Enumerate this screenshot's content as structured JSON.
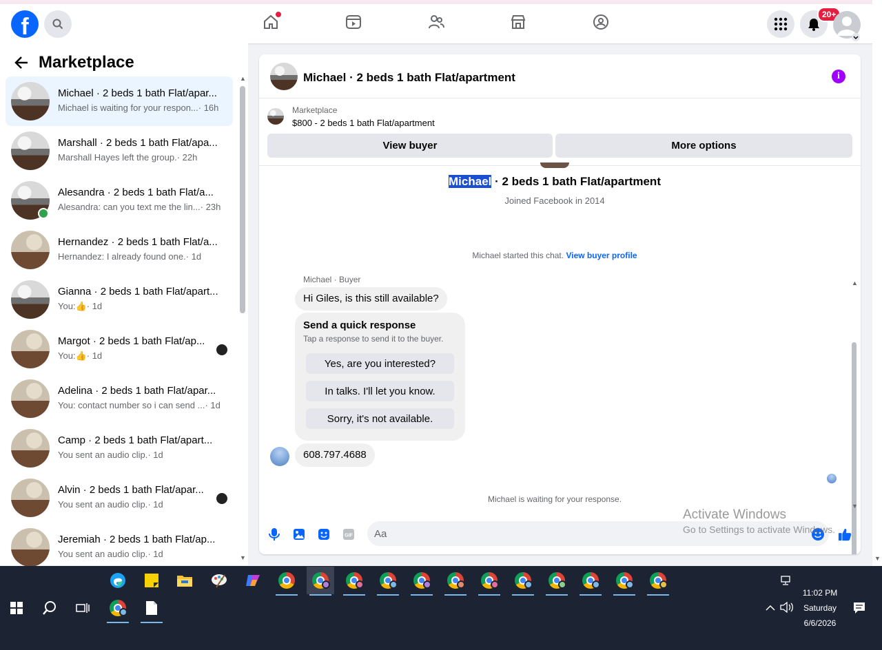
{
  "topbar": {
    "logo_letter": "f",
    "notification_badge": "20+",
    "icons": [
      "search-icon",
      "home-icon",
      "video-icon",
      "friends-icon",
      "marketplace-icon",
      "groups-icon",
      "menu-grid-icon",
      "bell-icon",
      "account-icon"
    ]
  },
  "left": {
    "title": "Marketplace",
    "conversations": [
      {
        "title": "Michael · 2 beds 1 bath Flat/apar...",
        "preview": "Michael is waiting for your respon...",
        "time": "· 16h",
        "active": true
      },
      {
        "title": "Marshall · 2 beds 1 bath Flat/apa...",
        "preview": "Marshall Hayes left the group.",
        "time": "· 22h"
      },
      {
        "title": "Alesandra · 2 beds 1 bath Flat/a...",
        "preview": "Alesandra: can you text me the lin...",
        "time": "· 23h",
        "online": true
      },
      {
        "title": "Hernandez · 2 beds 1 bath Flat/a...",
        "preview": "Hernandez: I already found one.",
        "time": "· 1d"
      },
      {
        "title": "Gianna · 2 beds 1 bath Flat/apart...",
        "preview": "You:",
        "time": "· 1d",
        "like": true
      },
      {
        "title": "Margot · 2 beds 1 bath Flat/ap...",
        "preview": "You:",
        "time": "· 1d",
        "like": true,
        "seen": true
      },
      {
        "title": "Adelina · 2 beds 1 bath Flat/apar...",
        "preview": "You: contact number so i can send ...",
        "time": "· 1d"
      },
      {
        "title": "Camp · 2 beds 1 bath Flat/apart...",
        "preview": "You sent an audio clip.",
        "time": "· 1d"
      },
      {
        "title": "Alvin · 2 beds 1 bath Flat/apar...",
        "preview": "You sent an audio clip.",
        "time": "· 1d",
        "seen": true
      },
      {
        "title": "Jeremiah · 2 beds 1 bath Flat/ap...",
        "preview": "You sent an audio clip.",
        "time": "· 1d"
      }
    ]
  },
  "chat": {
    "header_name": "Michael · 2 beds 1 bath Flat/apartment",
    "listing_source": "Marketplace",
    "listing_price": "$800 - 2 beds 1 bath Flat/apartment",
    "view_buyer": "View buyer",
    "more_options": "More options",
    "profile_first": "Michael",
    "profile_rest": " · 2 beds 1 bath Flat/apartment",
    "joined": "Joined Facebook in 2014",
    "started_text": "Michael started this chat.",
    "view_buyer_profile": "View buyer profile",
    "sender_label": "Michael · Buyer",
    "first_message": "Hi Giles, is this still available?",
    "quick_title": "Send a quick response",
    "quick_sub": "Tap a response to send it to the buyer.",
    "quick_options": [
      "Yes, are you interested?",
      "In talks. I'll let you know.",
      "Sorry, it's not available."
    ],
    "phone_message": "608.797.4688",
    "waiting": "Michael is waiting for your response.",
    "composer_placeholder": "Aa"
  },
  "watermark": {
    "line1": "Activate Windows",
    "line2": "Go to Settings to activate Windows."
  },
  "taskbar": {
    "time": "11:02 PM",
    "day": "Saturday",
    "date": "6/6/2026"
  },
  "colors": {
    "accent": "#0866ff",
    "info": "#a100ff",
    "badge": "#e41e3f",
    "online": "#31a24c"
  }
}
